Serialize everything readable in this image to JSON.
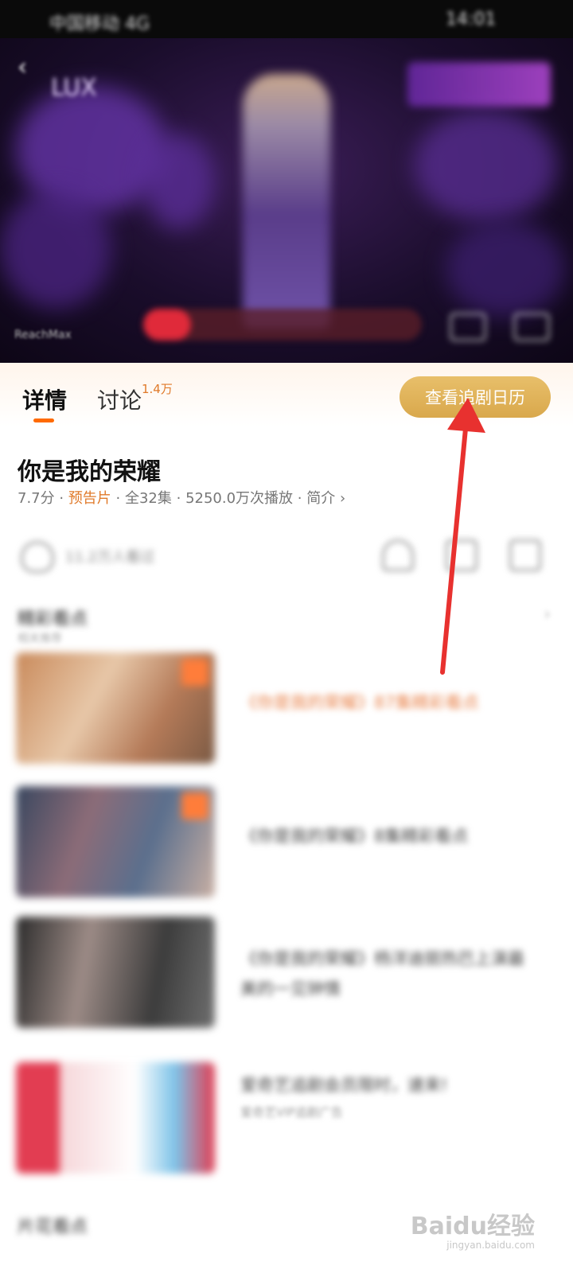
{
  "status_bar": {
    "left_text": "中国移动 4G",
    "right_text": "14:01"
  },
  "video": {
    "brand": "LUX",
    "watermark": "ReachMax"
  },
  "tabs": [
    {
      "label": "详情"
    },
    {
      "label": "讨论",
      "badge": "1.4万"
    }
  ],
  "calendar_button": {
    "label": "查看追剧日历"
  },
  "show": {
    "title": "你是我的荣耀",
    "rating": "7.7分",
    "separator": " · ",
    "tag": "预告片",
    "episodes": "全32集",
    "plays": "5250.0万次播放",
    "intro": "简介",
    "intro_chevron": "›"
  },
  "actions": {
    "like_count": "11.2万人看过"
  },
  "section": {
    "title": "精彩看点",
    "subtitle": "相关推荐",
    "more": "›"
  },
  "items": [
    {
      "title": "《你是我的荣耀》87集精彩看点"
    },
    {
      "title": "《你是我的荣耀》8集精彩看点"
    },
    {
      "title": "《你是我的荣耀》杨洋迪丽热巴上演最美的一见钟情"
    },
    {
      "title": "爱奇艺追剧会员限时，速来!",
      "sub": "爱奇艺VIP追剧广告"
    }
  ],
  "bottom_section": {
    "title": "片花看点"
  },
  "footer_watermark": {
    "logo": "Baidu经验",
    "url": "jingyan.baidu.com"
  },
  "colors": {
    "accent": "#e07a2a",
    "button": "#d9a84c",
    "arrow": "#e8312f",
    "underline": "#ff6a00"
  }
}
